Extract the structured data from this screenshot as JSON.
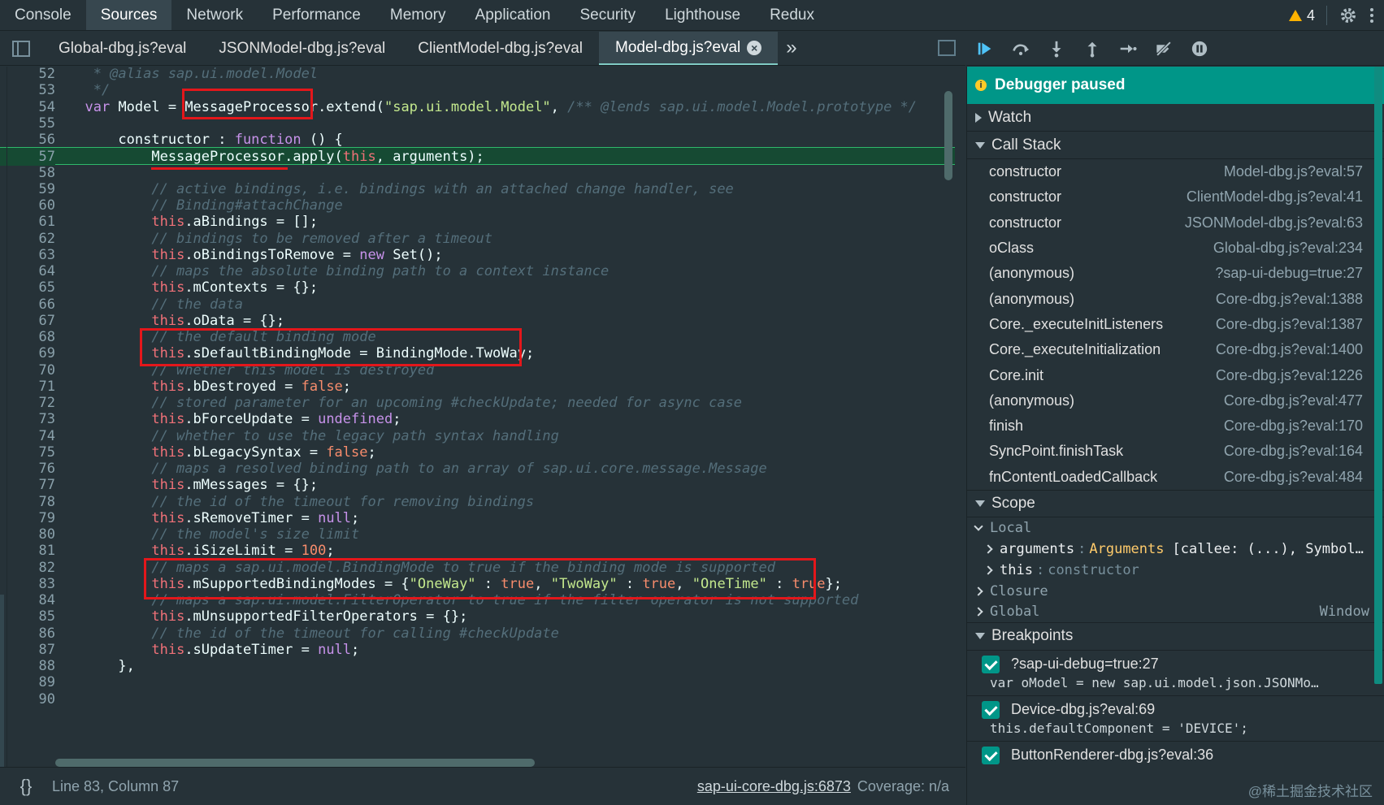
{
  "top_tabs": [
    "Console",
    "Sources",
    "Network",
    "Performance",
    "Memory",
    "Application",
    "Security",
    "Lighthouse",
    "Redux"
  ],
  "active_top_tab": "Sources",
  "warning_count": "4",
  "file_tabs": [
    "Global-dbg.js?eval",
    "JSONModel-dbg.js?eval",
    "ClientModel-dbg.js?eval",
    "Model-dbg.js?eval"
  ],
  "active_file_tab": "Model-dbg.js?eval",
  "more_tabs": "»",
  "code_lines": [
    {
      "n": "52",
      "html": "<span class=\"cm\">   * @alias sap.ui.model.Model</span>"
    },
    {
      "n": "53",
      "html": "<span class=\"cm\">   */</span>"
    },
    {
      "n": "54",
      "html": "  <span class=\"kw\">var</span> Model = MessageProcessor.extend(<span class=\"str\">\"sap.ui.model.Model\"</span>, <span class=\"cm\">/** @lends sap.ui.model.Model.prototype */</span>"
    },
    {
      "n": "55",
      "html": ""
    },
    {
      "n": "56",
      "html": "      constructor : <span class=\"kw\">function</span> () {"
    },
    {
      "n": "57",
      "html": "          MessageProcessor.apply(<span class=\"th\">this</span>, arguments);",
      "exec": true
    },
    {
      "n": "58",
      "html": ""
    },
    {
      "n": "59",
      "html": "<span class=\"cm\">          // active bindings, i.e. bindings with an attached change handler, see</span>"
    },
    {
      "n": "60",
      "html": "<span class=\"cm\">          // Binding#attachChange</span>"
    },
    {
      "n": "61",
      "html": "          <span class=\"th\">this</span>.aBindings = [];"
    },
    {
      "n": "62",
      "html": "<span class=\"cm\">          // bindings to be removed after a timeout</span>"
    },
    {
      "n": "63",
      "html": "          <span class=\"th\">this</span>.oBindingsToRemove = <span class=\"kw\">new</span> Set();"
    },
    {
      "n": "64",
      "html": "<span class=\"cm\">          // maps the absolute binding path to a context instance</span>"
    },
    {
      "n": "65",
      "html": "          <span class=\"th\">this</span>.mContexts = {};"
    },
    {
      "n": "66",
      "html": "<span class=\"cm\">          // the data</span>"
    },
    {
      "n": "67",
      "html": "          <span class=\"th\">this</span>.oData = {};"
    },
    {
      "n": "68",
      "html": "<span class=\"cm\">          // the default binding mode</span>"
    },
    {
      "n": "69",
      "html": "          <span class=\"th\">this</span>.sDefaultBindingMode = BindingMode.TwoWay;"
    },
    {
      "n": "70",
      "html": "<span class=\"cm\">          // whether this model is destroyed</span>"
    },
    {
      "n": "71",
      "html": "          <span class=\"th\">this</span>.bDestroyed = <span class=\"bool\">false</span>;"
    },
    {
      "n": "72",
      "html": "<span class=\"cm\">          // stored parameter for an upcoming #checkUpdate; needed for async case</span>"
    },
    {
      "n": "73",
      "html": "          <span class=\"th\">this</span>.bForceUpdate = <span class=\"kw\">undefined</span>;"
    },
    {
      "n": "74",
      "html": "<span class=\"cm\">          // whether to use the legacy path syntax handling</span>"
    },
    {
      "n": "75",
      "html": "          <span class=\"th\">this</span>.bLegacySyntax = <span class=\"bool\">false</span>;"
    },
    {
      "n": "76",
      "html": "<span class=\"cm\">          // maps a resolved binding path to an array of sap.ui.core.message.Message</span>"
    },
    {
      "n": "77",
      "html": "          <span class=\"th\">this</span>.mMessages = {};"
    },
    {
      "n": "78",
      "html": "<span class=\"cm\">          // the id of the timeout for removing bindings</span>"
    },
    {
      "n": "79",
      "html": "          <span class=\"th\">this</span>.sRemoveTimer = <span class=\"kw\">null</span>;"
    },
    {
      "n": "80",
      "html": "<span class=\"cm\">          // the model's size limit</span>"
    },
    {
      "n": "81",
      "html": "          <span class=\"th\">this</span>.iSizeLimit = <span class=\"num\">100</span>;"
    },
    {
      "n": "82",
      "html": "<span class=\"cm\">          // maps a sap.ui.model.BindingMode to true if the binding mode is supported</span>"
    },
    {
      "n": "83",
      "html": "          <span class=\"th\">this</span>.mSupportedBindingModes = {<span class=\"str\">\"OneWay\"</span> : <span class=\"bool\">true</span>, <span class=\"str\">\"TwoWay\"</span> : <span class=\"bool\">true</span>, <span class=\"str\">\"OneTime\"</span> : <span class=\"bool\">true</span>};"
    },
    {
      "n": "84",
      "html": "<span class=\"cm\">          // maps a sap.ui.model.FilterOperator to true if the filter operator is not supported</span>"
    },
    {
      "n": "85",
      "html": "          <span class=\"th\">this</span>.mUnsupportedFilterOperators = {};"
    },
    {
      "n": "86",
      "html": "<span class=\"cm\">          // the id of the timeout for calling #checkUpdate</span>"
    },
    {
      "n": "87",
      "html": "          <span class=\"th\">this</span>.sUpdateTimer = <span class=\"kw\">null</span>;"
    },
    {
      "n": "88",
      "html": "      },"
    },
    {
      "n": "89",
      "html": ""
    },
    {
      "n": "90",
      "html": ""
    }
  ],
  "status": {
    "braces": "{}",
    "position": "Line 83, Column 87",
    "source_link": "sap-ui-core-dbg.js:6873",
    "coverage": "Coverage: n/a"
  },
  "sidebar": {
    "paused_banner": "Debugger paused",
    "watch": "Watch",
    "call_stack": "Call Stack",
    "frames": [
      {
        "fn": "constructor",
        "loc": "Model-dbg.js?eval:57"
      },
      {
        "fn": "constructor",
        "loc": "ClientModel-dbg.js?eval:41"
      },
      {
        "fn": "constructor",
        "loc": "JSONModel-dbg.js?eval:63"
      },
      {
        "fn": "oClass",
        "loc": "Global-dbg.js?eval:234"
      },
      {
        "fn": "(anonymous)",
        "loc": "?sap-ui-debug=true:27"
      },
      {
        "fn": "(anonymous)",
        "loc": "Core-dbg.js?eval:1388"
      },
      {
        "fn": "Core._executeInitListeners",
        "loc": "Core-dbg.js?eval:1387"
      },
      {
        "fn": "Core._executeInitialization",
        "loc": "Core-dbg.js?eval:1400"
      },
      {
        "fn": "Core.init",
        "loc": "Core-dbg.js?eval:1226"
      },
      {
        "fn": "(anonymous)",
        "loc": "Core-dbg.js?eval:477"
      },
      {
        "fn": "finish",
        "loc": "Core-dbg.js?eval:170"
      },
      {
        "fn": "SyncPoint.finishTask",
        "loc": "Core-dbg.js?eval:164"
      },
      {
        "fn": "fnContentLoadedCallback",
        "loc": "Core-dbg.js?eval:484"
      }
    ],
    "scope": "Scope",
    "local": "Local",
    "arguments_key": "arguments",
    "arguments_val": "Arguments",
    "arguments_rest": "[callee: (...), Symbol…",
    "this_key": "this",
    "this_val": "constructor",
    "closure": "Closure",
    "global": "Global",
    "global_val": "Window",
    "breakpoints": "Breakpoints",
    "bps": [
      {
        "title": "?sap-ui-debug=true:27",
        "snippet": "var oModel = new sap.ui.model.json.JSONMo…"
      },
      {
        "title": "Device-dbg.js?eval:69",
        "snippet": "this.defaultComponent = 'DEVICE';"
      },
      {
        "title": "ButtonRenderer-dbg.js?eval:36",
        "snippet": ""
      }
    ],
    "watermark": "@稀土掘金技术社区"
  },
  "colors": {
    "accent": "#009688",
    "highlight_box": "#e3171b",
    "exec_line": "#164a33"
  }
}
